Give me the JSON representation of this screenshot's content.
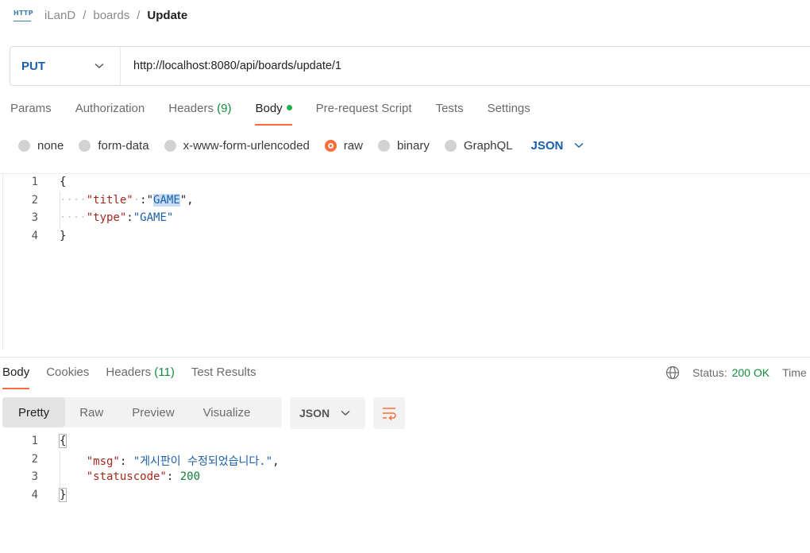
{
  "breadcrumb": {
    "workspace": "iLanD",
    "collection": "boards",
    "request": "Update",
    "icon_text": "HTTP"
  },
  "request": {
    "method": "PUT",
    "url": "http://localhost:8080/api/boards/update/1"
  },
  "request_tabs": {
    "params": "Params",
    "authorization": "Authorization",
    "headers": "Headers",
    "headers_count": "(9)",
    "body": "Body",
    "pre_request": "Pre-request Script",
    "tests": "Tests",
    "settings": "Settings"
  },
  "body_types": {
    "none": "none",
    "form_data": "form-data",
    "urlencoded": "x-www-form-urlencoded",
    "raw": "raw",
    "binary": "binary",
    "graphql": "GraphQL",
    "selected": "raw",
    "format": "JSON"
  },
  "request_body": {
    "ln": [
      "1",
      "2",
      "3",
      "4"
    ],
    "open": "{",
    "close": "}",
    "key1": "\"title\"",
    "val1": "GAME",
    "key2": "\"type\"",
    "val2": "\"GAME\""
  },
  "response_tabs": {
    "body": "Body",
    "cookies": "Cookies",
    "headers": "Headers",
    "headers_count": "(11)",
    "test_results": "Test Results"
  },
  "response_status": {
    "label": "Status:",
    "value": "200 OK",
    "time_label": "Time"
  },
  "response_view": {
    "pretty": "Pretty",
    "raw": "Raw",
    "preview": "Preview",
    "visualize": "Visualize",
    "format": "JSON"
  },
  "response_body": {
    "ln": [
      "1",
      "2",
      "3",
      "4"
    ],
    "open": "{",
    "close": "}",
    "key1": "\"msg\"",
    "val1": "\"게시판이 수정되었습니다.\"",
    "key2": "\"statuscode\"",
    "val2": "200"
  },
  "colors": {
    "accent": "#ff6c37",
    "method": "#1a5fa8",
    "ok": "#0f8f3a"
  }
}
